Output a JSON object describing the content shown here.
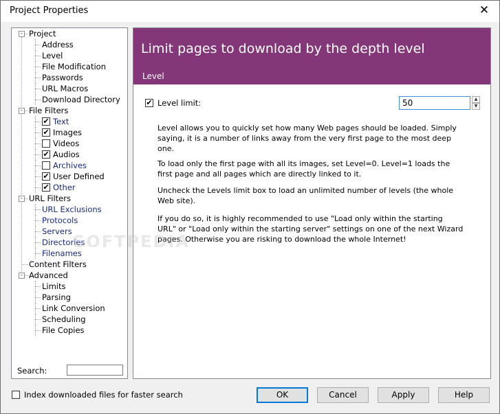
{
  "window": {
    "title": "Project Properties",
    "close_glyph": "✕"
  },
  "tree": [
    {
      "label": "Project",
      "level": 0,
      "expander": "-",
      "checkbox": null,
      "link": false
    },
    {
      "label": "Address",
      "level": 1,
      "checkbox": null,
      "link": false
    },
    {
      "label": "Level",
      "level": 1,
      "checkbox": null,
      "link": false
    },
    {
      "label": "File Modification",
      "level": 1,
      "checkbox": null,
      "link": false
    },
    {
      "label": "Passwords",
      "level": 1,
      "checkbox": null,
      "link": false
    },
    {
      "label": "URL Macros",
      "level": 1,
      "checkbox": null,
      "link": false
    },
    {
      "label": "Download Directory",
      "level": 1,
      "checkbox": null,
      "link": false
    },
    {
      "label": "File Filters",
      "level": 0,
      "expander": "-",
      "checkbox": null,
      "link": false
    },
    {
      "label": "Text",
      "level": 1,
      "checkbox": true,
      "link": true
    },
    {
      "label": "Images",
      "level": 1,
      "checkbox": true,
      "link": false
    },
    {
      "label": "Videos",
      "level": 1,
      "checkbox": false,
      "link": false
    },
    {
      "label": "Audios",
      "level": 1,
      "checkbox": true,
      "link": false
    },
    {
      "label": "Archives",
      "level": 1,
      "checkbox": false,
      "link": true
    },
    {
      "label": "User Defined",
      "level": 1,
      "checkbox": true,
      "link": false
    },
    {
      "label": "Other",
      "level": 1,
      "checkbox": true,
      "link": true
    },
    {
      "label": "URL Filters",
      "level": 0,
      "expander": "-",
      "checkbox": null,
      "link": false
    },
    {
      "label": "URL Exclusions",
      "level": 1,
      "checkbox": null,
      "link": true
    },
    {
      "label": "Protocols",
      "level": 1,
      "checkbox": null,
      "link": true
    },
    {
      "label": "Servers",
      "level": 1,
      "checkbox": null,
      "link": true
    },
    {
      "label": "Directories",
      "level": 1,
      "checkbox": null,
      "link": true
    },
    {
      "label": "Filenames",
      "level": 1,
      "checkbox": null,
      "link": true
    },
    {
      "label": "Content Filters",
      "level": 0,
      "expander": null,
      "checkbox": null,
      "link": false
    },
    {
      "label": "Advanced",
      "level": 0,
      "expander": "-",
      "checkbox": null,
      "link": false
    },
    {
      "label": "Limits",
      "level": 1,
      "checkbox": null,
      "link": false
    },
    {
      "label": "Parsing",
      "level": 1,
      "checkbox": null,
      "link": false
    },
    {
      "label": "Link Conversion",
      "level": 1,
      "checkbox": null,
      "link": false
    },
    {
      "label": "Scheduling",
      "level": 1,
      "checkbox": null,
      "link": false
    },
    {
      "label": "File Copies",
      "level": 1,
      "checkbox": null,
      "link": false
    }
  ],
  "search": {
    "label": "Search:",
    "value": ""
  },
  "header": {
    "title": "Limit pages to download by the depth level",
    "subtitle": "Level"
  },
  "level_limit": {
    "label": "Level limit:",
    "checked": true,
    "value": "50"
  },
  "paragraphs": [
    "Level allows you to quickly set how many Web pages should be loaded. Simply saying, it is a number of links away from the very first page to the most deep one.",
    "To load only the first page with all its images, set Level=0. Level=1 loads the first page and all pages which are directly linked to it.",
    "Uncheck the Levels limit box to load an unlimited number of levels (the whole Web site).",
    "If you do so, it is highly recommended to use \"Load only within the starting URL\" or \"Load only within the starting server\" settings on one of the next Wizard pages. Otherwise you are risking to download the whole Internet!"
  ],
  "index_option": {
    "label": "Index downloaded files for faster search",
    "checked": false
  },
  "buttons": {
    "ok": "OK",
    "cancel": "Cancel",
    "apply": "Apply",
    "help": "Help"
  },
  "watermark": "SOFTPEDIA",
  "colors": {
    "header_bg": "#833778",
    "link": "#1a2a80",
    "focus": "#0078d7"
  }
}
